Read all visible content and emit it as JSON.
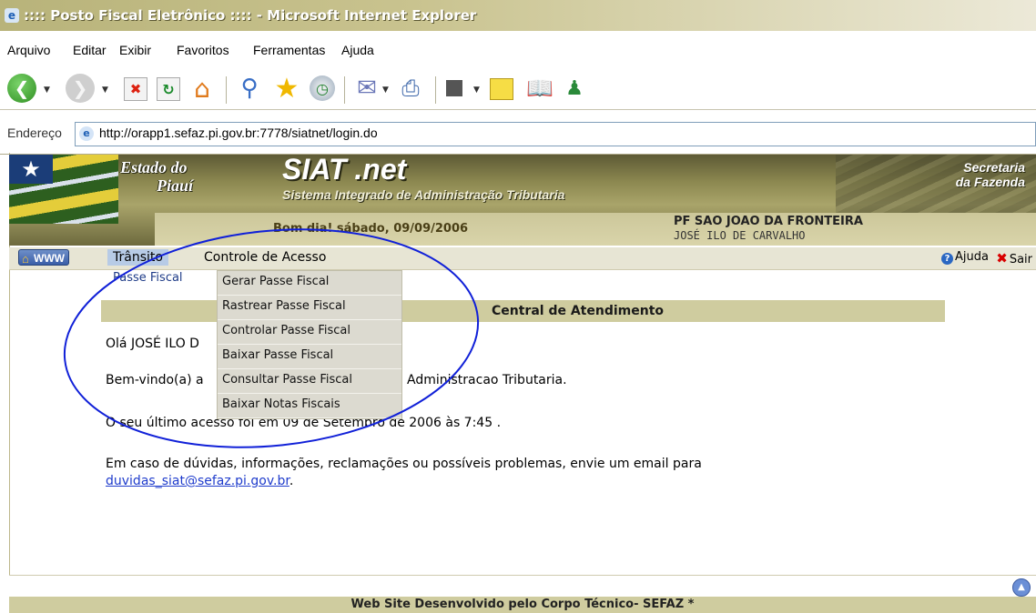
{
  "window": {
    "title": ":::: Posto Fiscal Eletrônico :::: - Microsoft Internet Explorer"
  },
  "menubar": [
    "Arquivo",
    "Editar",
    "Exibir",
    "Favoritos",
    "Ferramentas",
    "Ajuda"
  ],
  "address": {
    "label": "Endereço",
    "url": "http://orapp1.sefaz.pi.gov.br:7778/siatnet/login.do"
  },
  "banner": {
    "estado_line1": "Estado do",
    "estado_line2": "Piauí",
    "app_name": "SIAT .net",
    "app_subtitle": "Sistema Integrado de Administração Tributaria",
    "org_line1": "Secretaria",
    "org_line2": "da Fazenda",
    "greeting": "Bom dia! sábado, 09/09/2006",
    "post_name": "PF SAO JOAO DA FRONTEIRA",
    "user_name": "JOSÉ ILO DE CARVALHO"
  },
  "nav": {
    "www_label": "WWW",
    "items": [
      "Trânsito",
      "Controle de Acesso"
    ],
    "ajuda": "Ajuda",
    "sair": "Sair",
    "submenu": "Passe Fiscal",
    "dropdown": [
      "Gerar Passe Fiscal",
      "Rastrear Passe Fiscal",
      "Controlar Passe Fiscal",
      "Baixar Passe Fiscal",
      "Consultar Passe Fiscal",
      "Baixar Notas Fiscais"
    ]
  },
  "content": {
    "section_title": "Central de Atendimento",
    "hello": "Olá JOSÉ ILO D",
    "welcome_start": "Bem-vindo(a) a",
    "welcome_end": "Administracao Tributaria.",
    "last_access": "O seu último acesso foi em 09 de Setembro de 2006 às 7:45 .",
    "help_text": "Em caso de dúvidas, informações, reclamações ou possíveis problemas, envie um email para",
    "help_email": "duvidas_siat@sefaz.pi.gov.br",
    "help_end": "."
  },
  "footer": "Web Site Desenvolvido pelo Corpo Técnico- SEFAZ *",
  "colors": {
    "accent_olive": "#cfcc9f",
    "annotation_ellipse": "#1020d8",
    "link": "#1f3ccc"
  }
}
